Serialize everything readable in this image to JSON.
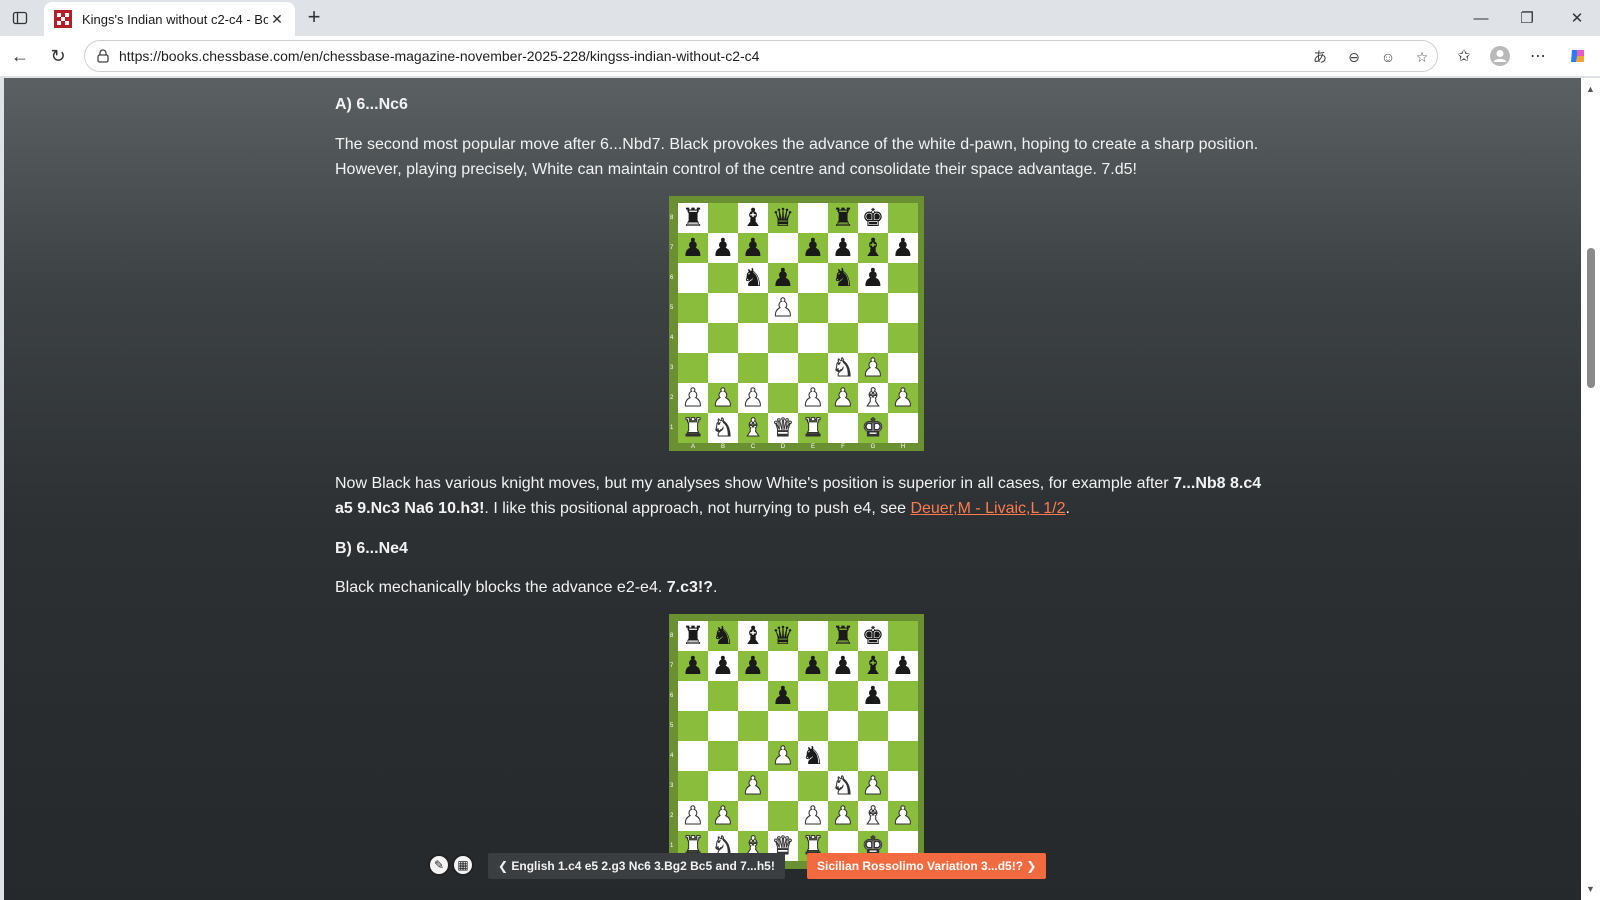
{
  "browser": {
    "tab_title": "Kings's Indian without c2-c4 - Boc",
    "url": "https://books.chessbase.com/en/chessbase-magazine-november-2025-228/kingss-indian-without-c2-c4"
  },
  "article": {
    "heading_a": "A) 6...Nc6",
    "para1": "The second most popular move after 6...Nbd7. Black provokes the advance of the white d-pawn, hoping to create a sharp position. However, playing precisely, White can maintain control of the centre and consolidate their space advantage. 7.d5!",
    "para2_text1": "Now Black has various knight moves, but my analyses show White's position is superior in all cases, for example after ",
    "para2_bold": "7...Nb8 8.c4 a5 9.Nc3 Na6 10.h3!",
    "para2_text2": ". I like this positional approach, not hurrying to push e4, see ",
    "para2_link": "Deuer,M - Livaic,L 1/2",
    "para2_end": ".",
    "heading_b": "B) 6...Ne4",
    "para3_text": "Black mechanically blocks the advance e2-e4. ",
    "para3_bold": "7.c3!?",
    "para3_end": "."
  },
  "boards": {
    "board1": [
      "r.bq.rk.",
      "ppp.ppbp",
      "..np.np.",
      "...P....",
      "........",
      ".....NP.",
      "PPP.PPBP",
      "RNBQR.K."
    ],
    "board2": [
      "rnbq.rk.",
      "ppp.ppbp",
      "...p..p.",
      "........",
      "...Pn...",
      "..P..NP.",
      "PP..PPBP",
      "RNBQR.K."
    ],
    "rank_labels": [
      "8",
      "7",
      "6",
      "5",
      "4",
      "3",
      "2",
      "1"
    ],
    "file_labels": [
      "A",
      "B",
      "C",
      "D",
      "E",
      "F",
      "G",
      "H"
    ]
  },
  "bottom_nav": {
    "prev_label": "English 1.c4 e5 2.g3 Nc6 3.Bg2 Bc5 and 7...h5!",
    "next_label": "Sicilian Rossolimo Variation 3...d5!?"
  }
}
